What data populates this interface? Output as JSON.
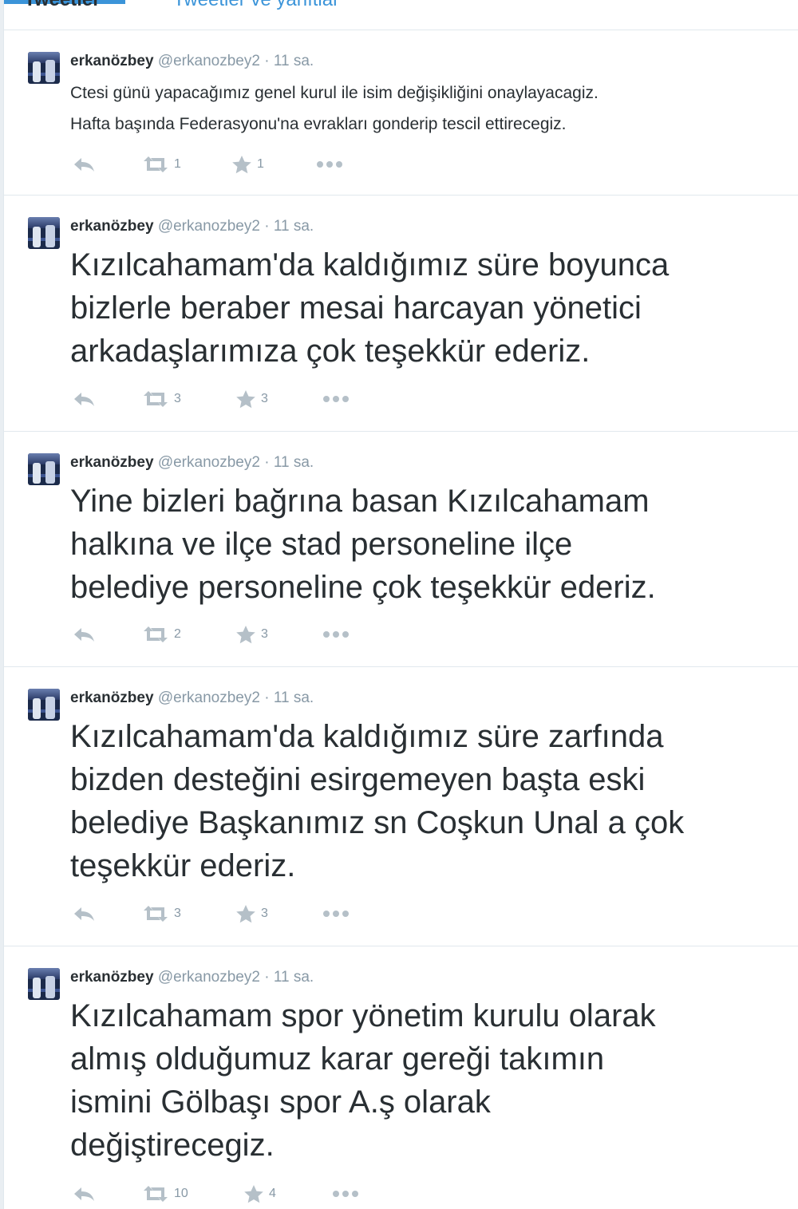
{
  "tabs": {
    "tweets_label": "Tweetler",
    "replies_label": "Tweetler ve yanıtlar"
  },
  "tweets": [
    {
      "name": "erkanözbey",
      "handle": "@erkanozbey2",
      "separator": "·",
      "time": "11 sa.",
      "text": "Ctesi günü yapacağımız genel kurul ile isim değişikliğini onaylayacagiz.\nHafta başında Federasyonu'na evrakları gonderip tescil ettirecegiz.",
      "retweets": "1",
      "favorites": "1"
    },
    {
      "name": "erkanözbey",
      "handle": "@erkanozbey2",
      "separator": "·",
      "time": "11 sa.",
      "text": "Kızılcahamam'da kaldığımız süre boyunca\nbizlerle beraber mesai harcayan yönetici\narkadaşlarımıza çok teşekkür ederiz.",
      "retweets": "3",
      "favorites": "3"
    },
    {
      "name": "erkanözbey",
      "handle": "@erkanozbey2",
      "separator": "·",
      "time": "11 sa.",
      "text": "Yine bizleri bağrına basan Kızılcahamam\nhalkına ve ilçe stad personeline ilçe\nbelediye personeline çok teşekkür ederiz.",
      "retweets": "2",
      "favorites": "3"
    },
    {
      "name": "erkanözbey",
      "handle": "@erkanozbey2",
      "separator": "·",
      "time": "11 sa.",
      "text": "Kızılcahamam'da kaldığımız süre zarfında\nbizden desteğini esirgemeyen başta eski\nbelediye Başkanımız sn Coşkun Unal a çok\nteşekkür ederiz.",
      "retweets": "3",
      "favorites": "3"
    },
    {
      "name": "erkanözbey",
      "handle": "@erkanozbey2",
      "separator": "·",
      "time": "11 sa.",
      "text": "Kızılcahamam spor yönetim kurulu olarak\nalmış olduğumuz karar gereği takımın\nismini Gölbaşı spor A.ş olarak\ndeğiştirecegiz.",
      "retweets": "10",
      "favorites": "4"
    }
  ],
  "icons": {
    "reply": "reply-icon",
    "retweet": "retweet-icon",
    "favorite": "star-icon",
    "more": "more-icon",
    "icon_color": "#b5c0c8"
  }
}
